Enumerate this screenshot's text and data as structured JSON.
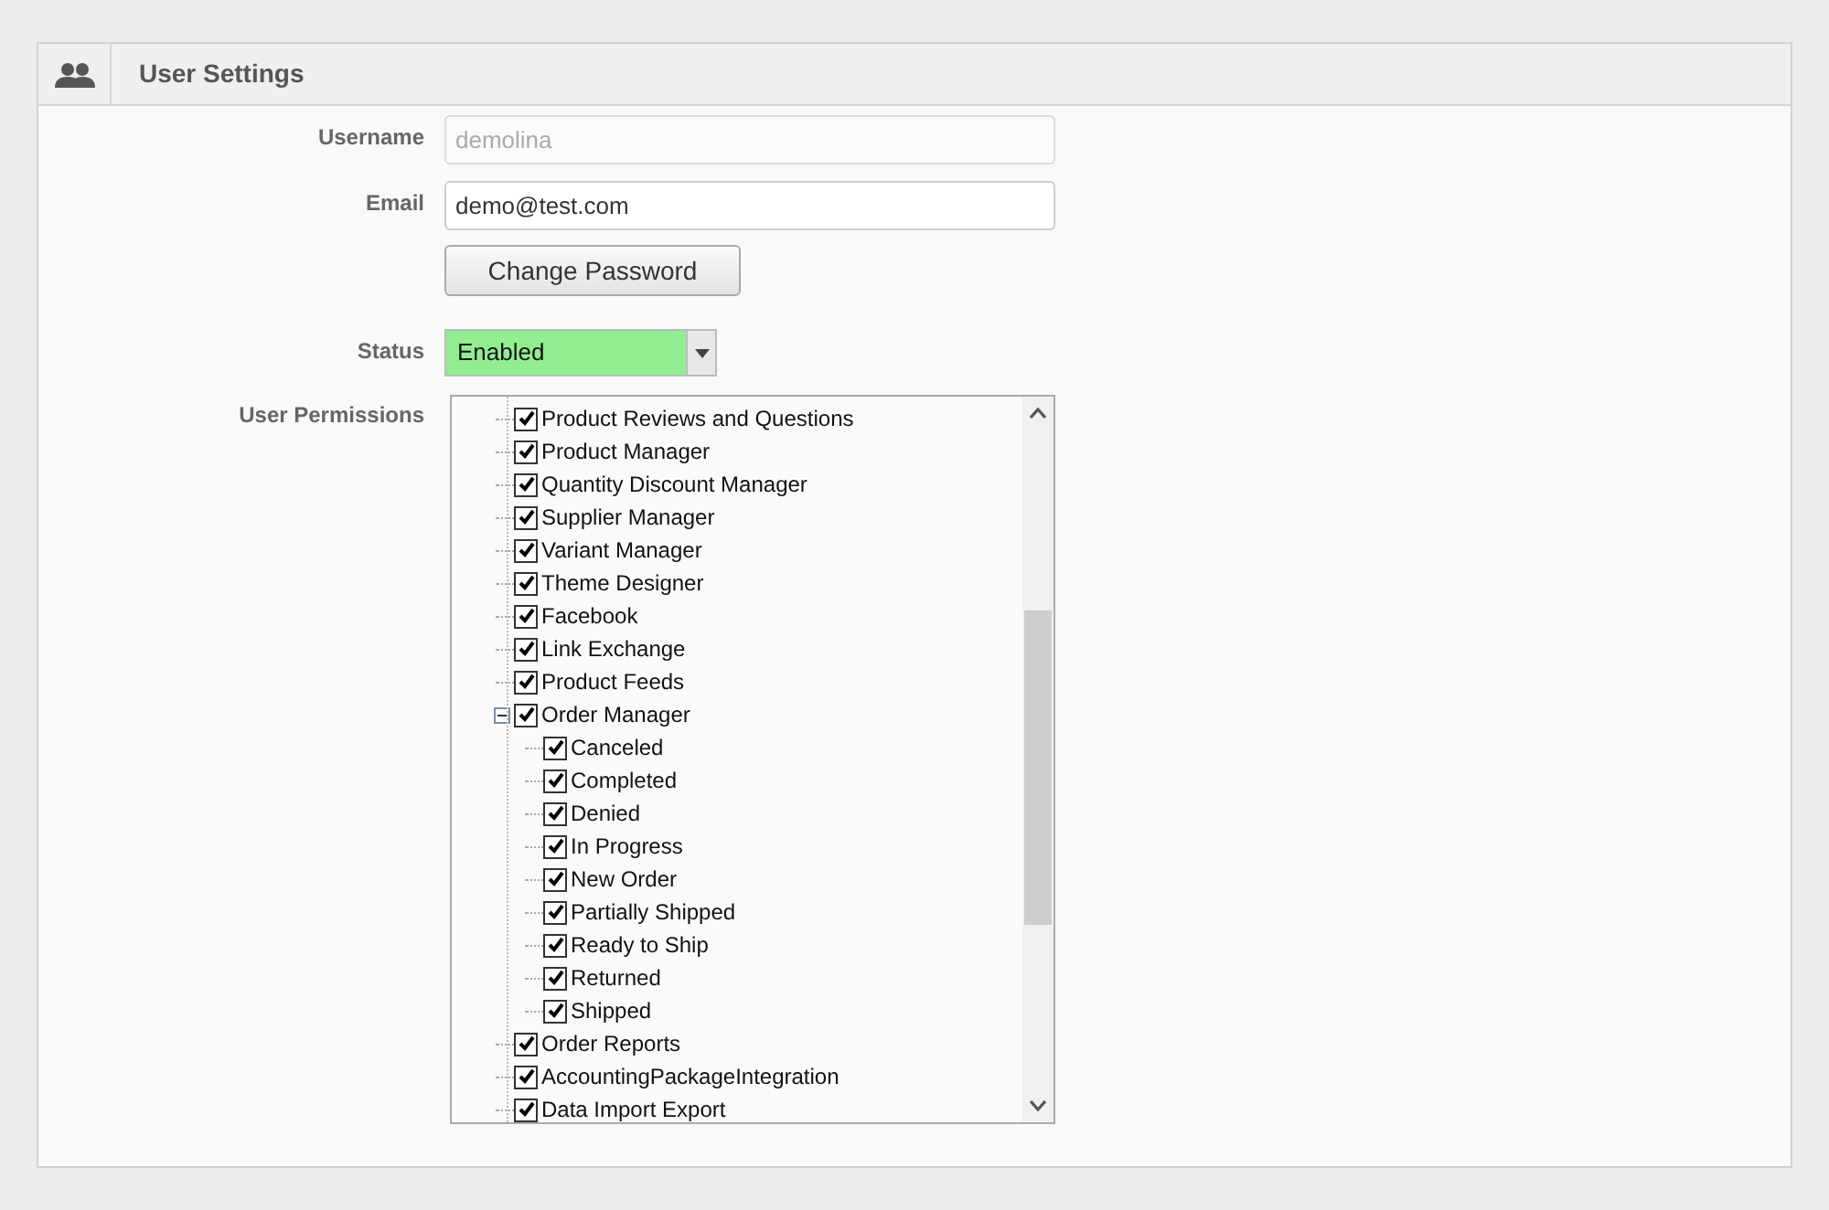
{
  "panel": {
    "title": "User Settings"
  },
  "form": {
    "username": {
      "label": "Username",
      "value": "demolina",
      "disabled": true
    },
    "email": {
      "label": "Email",
      "value": "demo@test.com"
    },
    "change_password": "Change Password",
    "status": {
      "label": "Status",
      "value": "Enabled",
      "color": "#90ee90"
    },
    "permissions": {
      "label": "User Permissions",
      "items": [
        {
          "label": "Product Reviews and Questions",
          "checked": true
        },
        {
          "label": "Product Manager",
          "checked": true
        },
        {
          "label": "Quantity Discount Manager",
          "checked": true
        },
        {
          "label": "Supplier Manager",
          "checked": true
        },
        {
          "label": "Variant Manager",
          "checked": true
        },
        {
          "label": "Theme Designer",
          "checked": true
        },
        {
          "label": "Facebook",
          "checked": true
        },
        {
          "label": "Link Exchange",
          "checked": true
        },
        {
          "label": "Product Feeds",
          "checked": true
        },
        {
          "label": "Order Manager",
          "checked": true,
          "expanded": true,
          "children": [
            {
              "label": "Canceled",
              "checked": true
            },
            {
              "label": "Completed",
              "checked": true
            },
            {
              "label": "Denied",
              "checked": true
            },
            {
              "label": "In Progress",
              "checked": true
            },
            {
              "label": "New Order",
              "checked": true
            },
            {
              "label": "Partially Shipped",
              "checked": true
            },
            {
              "label": "Ready to Ship",
              "checked": true
            },
            {
              "label": "Returned",
              "checked": true
            },
            {
              "label": "Shipped",
              "checked": true
            }
          ]
        },
        {
          "label": "Order Reports",
          "checked": true
        },
        {
          "label": "AccountingPackageIntegration",
          "checked": true
        },
        {
          "label": "Data Import Export",
          "checked": true
        }
      ]
    }
  }
}
